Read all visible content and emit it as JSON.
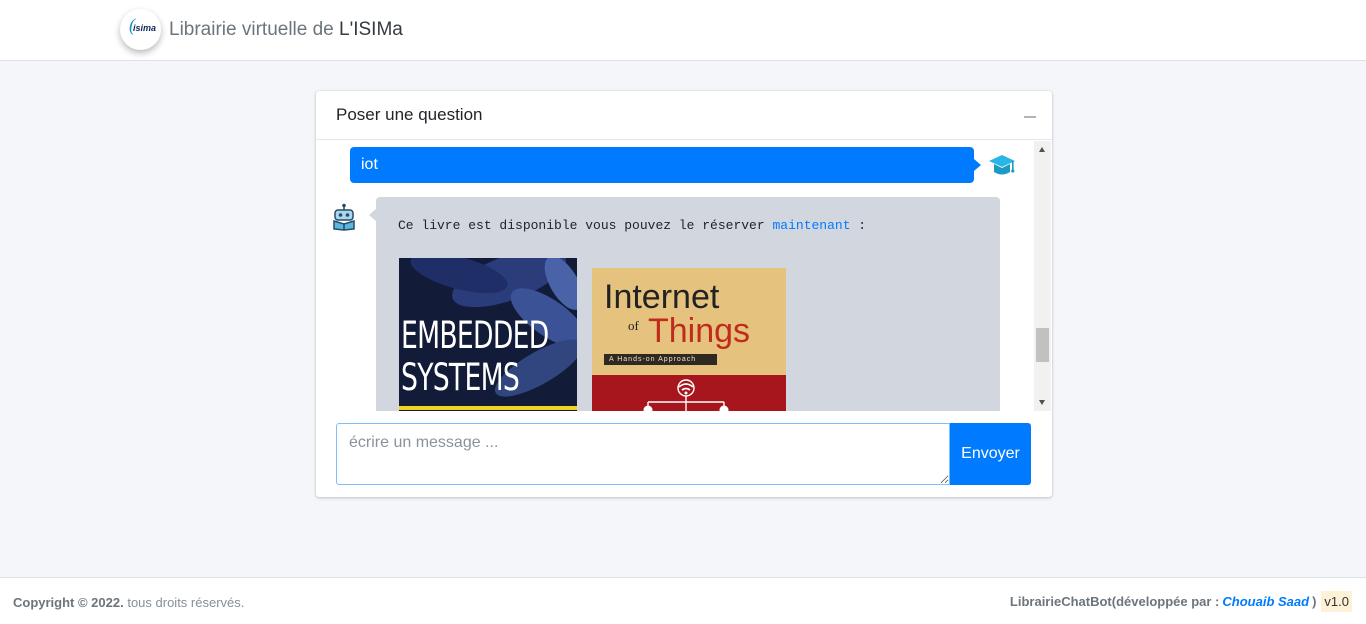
{
  "navbar": {
    "logo_text": "isima",
    "brand_prefix": "Librairie virtuelle de ",
    "brand_name": "L'ISIMa"
  },
  "chat": {
    "header_title": "Poser une question",
    "user_message": "iot",
    "bot_message": "Ce livre est disponible vous pouvez le réserver",
    "bot_link": "maintenant",
    "bot_suffix": " :",
    "books": [
      {
        "cover_line1": "EMBEDDED",
        "cover_line2": "SYSTEMS"
      },
      {
        "cover_line1": "Internet",
        "cover_of": "of",
        "cover_line2": "Things",
        "cover_band": "A Hands-on Approach"
      }
    ],
    "input_placeholder": "écrire un message ...",
    "send_label": "Envoyer"
  },
  "footer": {
    "copyright": "Copyright © 2022.",
    "rights": " tous droits réservés.",
    "app_name": "LibrairieChatBot",
    "dev_prefix": " (développée par : ",
    "author": "Chouaib Saad",
    "dev_suffix": " )",
    "version": "v1.0"
  },
  "colors": {
    "primary": "#007bff",
    "bot_bubble": "#d2d6de",
    "background": "#f4f6f9",
    "user_avatar": "#29b6e6"
  }
}
